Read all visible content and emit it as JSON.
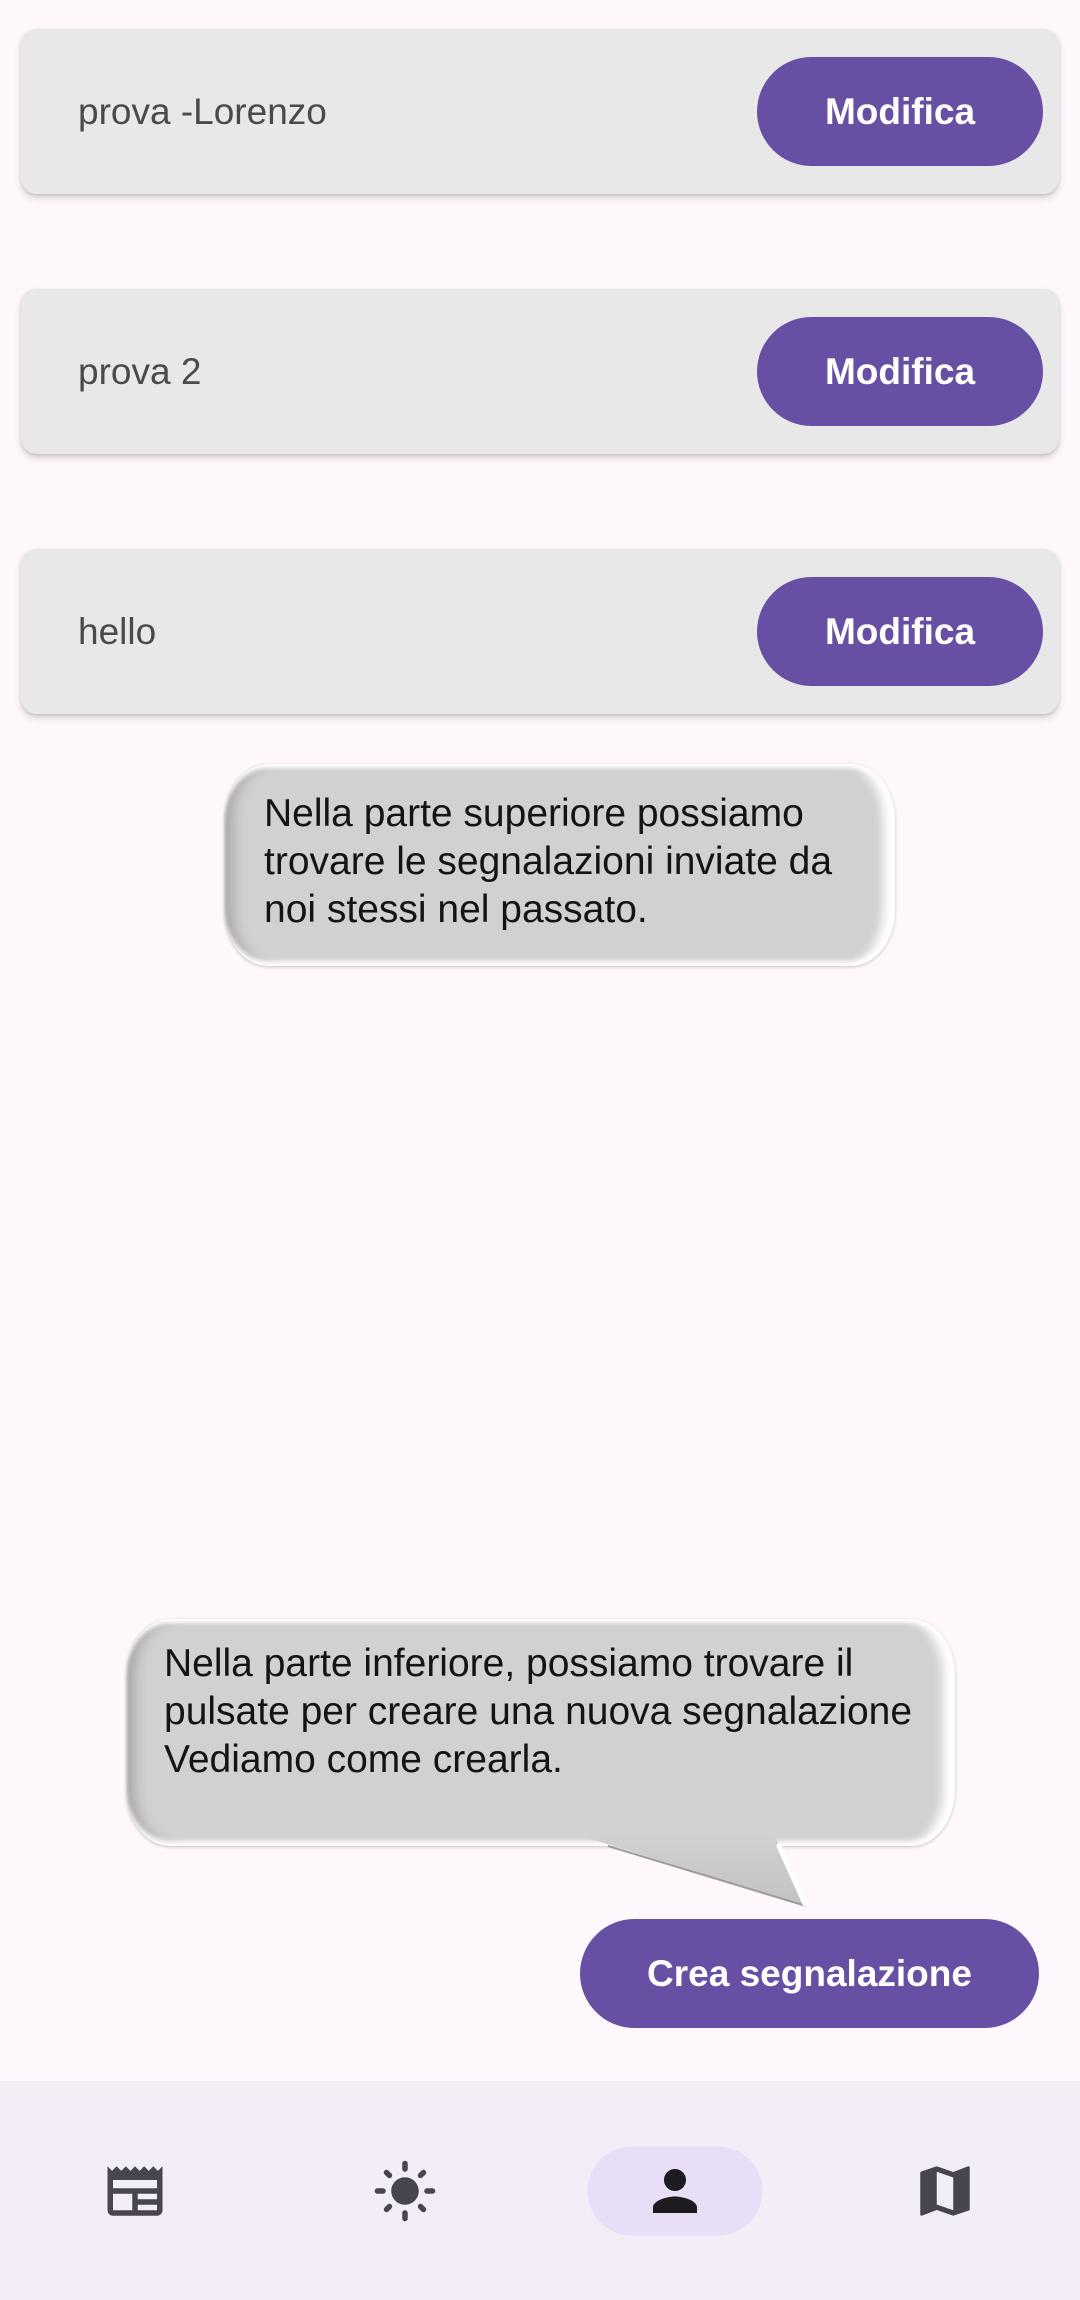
{
  "colors": {
    "page_background": "#fef7fc",
    "accent": "#6750a4",
    "card_background": "#e8e8e8",
    "nav_background": "#f3edf7",
    "nav_active_indicator": "#e8def8"
  },
  "reports": [
    {
      "title": "prova -Lorenzo",
      "action_label": "Modifica"
    },
    {
      "title": "prova 2",
      "action_label": "Modifica"
    },
    {
      "title": "hello",
      "action_label": "Modifica"
    }
  ],
  "tutorial": {
    "bubble_top": {
      "lines": [
        "Nella parte superiore possiamo",
        "trovare le segnalazioni inviate da",
        "noi stessi nel passato."
      ]
    },
    "bubble_bottom": {
      "lines": [
        "Nella parte inferiore, possiamo trovare il",
        "pulsate per creare una nuova segnalazione",
        "Vediamo come crearla."
      ]
    }
  },
  "create_button": {
    "label": "Crea segnalazione"
  },
  "bottom_nav": {
    "items": [
      {
        "icon": "newspaper-icon",
        "active": false
      },
      {
        "icon": "sun-icon",
        "active": false
      },
      {
        "icon": "person-icon",
        "active": true
      },
      {
        "icon": "map-icon",
        "active": false
      }
    ]
  }
}
